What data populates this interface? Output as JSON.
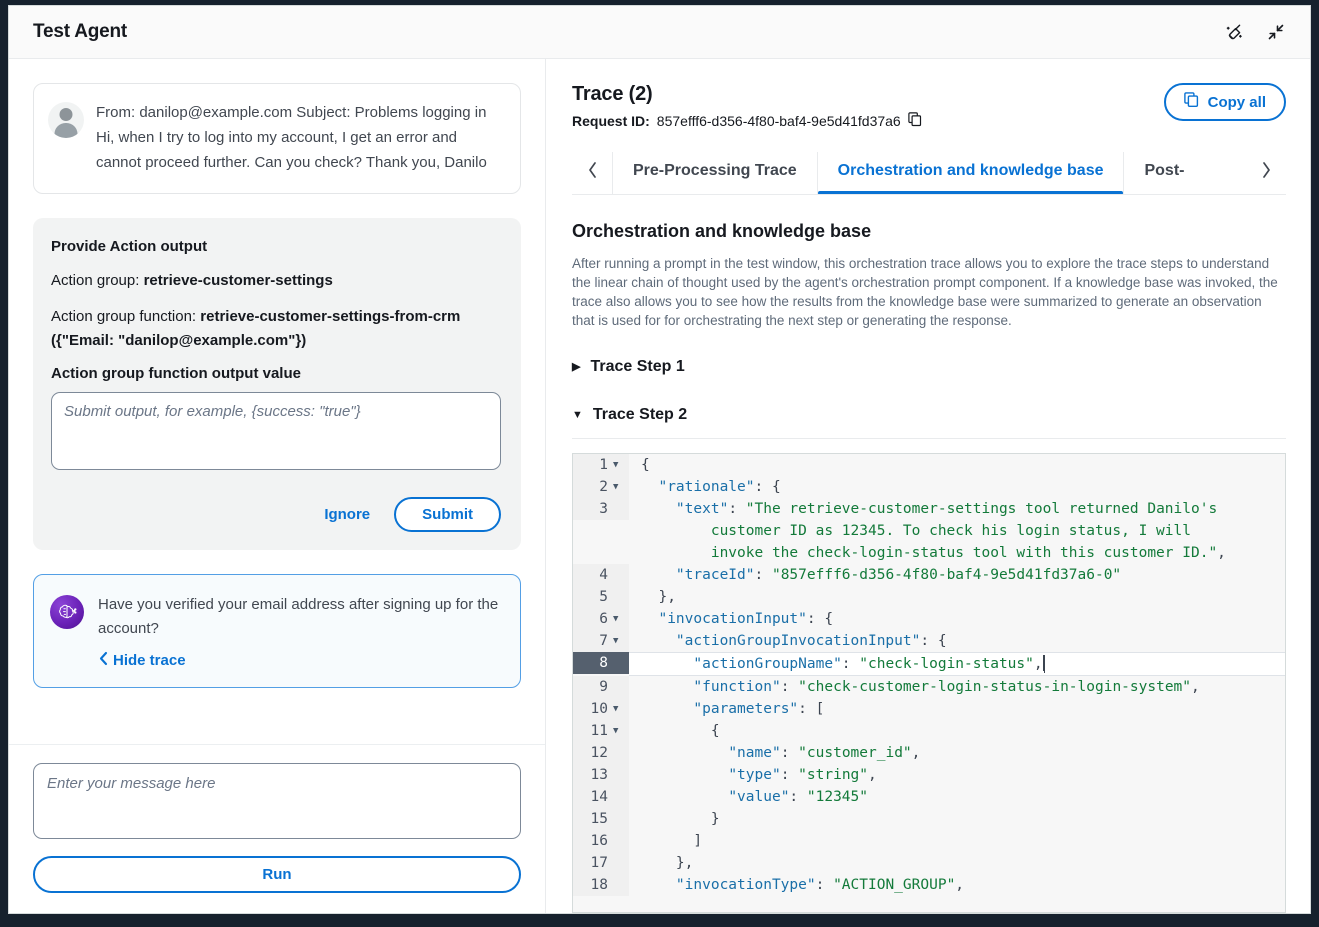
{
  "window": {
    "title": "Test Agent",
    "icons": [
      {
        "name": "broom-clear-icon",
        "label": "Clear"
      },
      {
        "name": "collapse-icon",
        "label": "Collapse"
      }
    ]
  },
  "conversation": {
    "user_message": "From: danilop@example.com Subject: Problems logging in Hi, when I try to log into my account, I get an error and cannot proceed further. Can you check? Thank you, Danilo",
    "agent_message": "Have you verified your email address after signing up for the account?",
    "hide_trace_label": "Hide trace"
  },
  "action_output": {
    "title": "Provide Action output",
    "action_group_label": "Action group:",
    "action_group_value": "retrieve-customer-settings",
    "action_group_function_label": "Action group function:",
    "action_group_function_value": "retrieve-customer-settings-from-crm ({\"Email: \"danilop@example.com\"})",
    "output_value_label": "Action group function output value",
    "output_placeholder": "Submit output, for example, {success: \"true\"}",
    "output_value": "",
    "ignore_label": "Ignore",
    "submit_label": "Submit"
  },
  "composer": {
    "placeholder": "Enter your message here",
    "value": "",
    "run_label": "Run"
  },
  "trace": {
    "title": "Trace (2)",
    "request_id_label": "Request ID:",
    "request_id_value": "857efff6-d356-4f80-baf4-9e5d41fd37a6",
    "copy_all_label": "Copy all",
    "tabs": [
      {
        "label": "Pre-Processing Trace",
        "active": false
      },
      {
        "label": "Orchestration and knowledge base",
        "active": true
      },
      {
        "label": "Post-",
        "active": false
      }
    ],
    "section_title": "Orchestration and knowledge base",
    "section_description": "After running a prompt in the test window, this orchestration trace allows you to explore the trace steps to understand the linear chain of thought used by the agent's orchestration prompt component. If a knowledge base was invoked, the trace also allows you to see how the results from the knowledge base were summarized to generate an observation that is used for for orchestrating the next step or generating the response.",
    "steps": [
      {
        "label": "Trace Step 1",
        "expanded": false,
        "marker": "▶"
      },
      {
        "label": "Trace Step 2",
        "expanded": true,
        "marker": "▼"
      }
    ]
  },
  "code": {
    "highlight_line": 8,
    "lines": [
      {
        "n": 1,
        "fold": "▼",
        "segments": [
          {
            "t": "{",
            "c": "p"
          }
        ]
      },
      {
        "n": 2,
        "fold": "▼",
        "segments": [
          {
            "t": "  \"rationale\"",
            "c": "k"
          },
          {
            "t": ": {",
            "c": "p"
          }
        ]
      },
      {
        "n": 3,
        "fold": "",
        "segments": [
          {
            "t": "    \"text\"",
            "c": "k"
          },
          {
            "t": ": ",
            "c": "p"
          },
          {
            "t": "\"The retrieve-customer-settings tool returned Danilo's\n        customer ID as 12345. To check his login status, I will\n        invoke the check-login-status tool with this customer ID.\"",
            "c": "s"
          },
          {
            "t": ",",
            "c": "p"
          }
        ]
      },
      {
        "n": 4,
        "fold": "",
        "segments": [
          {
            "t": "    \"traceId\"",
            "c": "k"
          },
          {
            "t": ": ",
            "c": "p"
          },
          {
            "t": "\"857efff6-d356-4f80-baf4-9e5d41fd37a6-0\"",
            "c": "s"
          }
        ]
      },
      {
        "n": 5,
        "fold": "",
        "segments": [
          {
            "t": "  },",
            "c": "p"
          }
        ]
      },
      {
        "n": 6,
        "fold": "▼",
        "segments": [
          {
            "t": "  \"invocationInput\"",
            "c": "k"
          },
          {
            "t": ": {",
            "c": "p"
          }
        ]
      },
      {
        "n": 7,
        "fold": "▼",
        "segments": [
          {
            "t": "    \"actionGroupInvocationInput\"",
            "c": "k"
          },
          {
            "t": ": {",
            "c": "p"
          }
        ]
      },
      {
        "n": 8,
        "fold": "",
        "segments": [
          {
            "t": "      \"actionGroupName\"",
            "c": "k"
          },
          {
            "t": ": ",
            "c": "p"
          },
          {
            "t": "\"check-login-status\"",
            "c": "s"
          },
          {
            "t": ",",
            "c": "p"
          }
        ]
      },
      {
        "n": 9,
        "fold": "",
        "segments": [
          {
            "t": "      \"function\"",
            "c": "k"
          },
          {
            "t": ": ",
            "c": "p"
          },
          {
            "t": "\"check-customer-login-status-in-login-system\"",
            "c": "s"
          },
          {
            "t": ",",
            "c": "p"
          }
        ]
      },
      {
        "n": 10,
        "fold": "▼",
        "segments": [
          {
            "t": "      \"parameters\"",
            "c": "k"
          },
          {
            "t": ": [",
            "c": "p"
          }
        ]
      },
      {
        "n": 11,
        "fold": "▼",
        "segments": [
          {
            "t": "        {",
            "c": "p"
          }
        ]
      },
      {
        "n": 12,
        "fold": "",
        "segments": [
          {
            "t": "          \"name\"",
            "c": "k"
          },
          {
            "t": ": ",
            "c": "p"
          },
          {
            "t": "\"customer_id\"",
            "c": "s"
          },
          {
            "t": ",",
            "c": "p"
          }
        ]
      },
      {
        "n": 13,
        "fold": "",
        "segments": [
          {
            "t": "          \"type\"",
            "c": "k"
          },
          {
            "t": ": ",
            "c": "p"
          },
          {
            "t": "\"string\"",
            "c": "s"
          },
          {
            "t": ",",
            "c": "p"
          }
        ]
      },
      {
        "n": 14,
        "fold": "",
        "segments": [
          {
            "t": "          \"value\"",
            "c": "k"
          },
          {
            "t": ": ",
            "c": "p"
          },
          {
            "t": "\"12345\"",
            "c": "s"
          }
        ]
      },
      {
        "n": 15,
        "fold": "",
        "segments": [
          {
            "t": "        }",
            "c": "p"
          }
        ]
      },
      {
        "n": 16,
        "fold": "",
        "segments": [
          {
            "t": "      ]",
            "c": "p"
          }
        ]
      },
      {
        "n": 17,
        "fold": "",
        "segments": [
          {
            "t": "    },",
            "c": "p"
          }
        ]
      },
      {
        "n": 18,
        "fold": "",
        "segments": [
          {
            "t": "    \"invocationType\"",
            "c": "k"
          },
          {
            "t": ": ",
            "c": "p"
          },
          {
            "t": "\"ACTION_GROUP\"",
            "c": "s"
          },
          {
            "t": ",",
            "c": "p"
          }
        ]
      }
    ]
  },
  "colors": {
    "accent_blue": "#0972d3",
    "agent_purple": "#6b22b8",
    "code_key": "#1a6fa8",
    "code_string": "#137a3a",
    "highlight_gutter": "#55606e"
  }
}
